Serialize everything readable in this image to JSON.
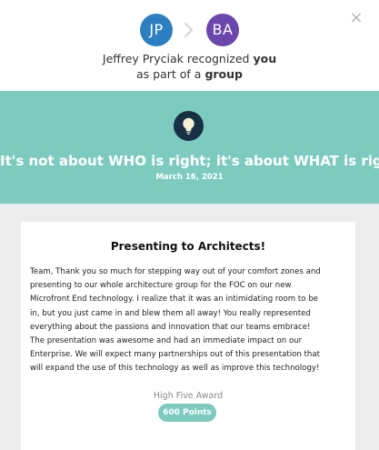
{
  "header": {
    "sender_initials": "JP",
    "recipient_initials": "BA",
    "sender_name": "Jeffrey Pryciak",
    "recognized_word": "recognized",
    "you_word": "you",
    "group_prefix": "as part of a",
    "group_word": "group",
    "close_symbol": "×"
  },
  "value": {
    "title": "It's not about WHO is right; it's about WHAT is right.",
    "date": "March 16, 2021",
    "icon": "lightbulb-icon"
  },
  "card": {
    "title": "Presenting to Architects!",
    "body_lines": [
      "Team, Thank you so much for stepping way out of your comfort zones and",
      "presenting to our whole architecture group for the FOC on our new",
      "Microfront End technology. I realize that it was an intimidating room to be",
      "in, but you just came in and blew them all away! You really represented",
      "everything about the passions and innovation that our teams embrace!",
      "The presentation was awesome and had an immediate impact on our",
      "Enterprise. We will expect many partnerships out of this presentation that",
      "will expand the use of this technology as well as improve this technology!"
    ],
    "award_label": "High Five Award",
    "points": "600 Points"
  },
  "colors": {
    "teal": "#7dcbbf",
    "sender_avatar": "#2c7fc1",
    "recipient_avatar": "#6a46ad",
    "badge_dark": "#183044"
  }
}
